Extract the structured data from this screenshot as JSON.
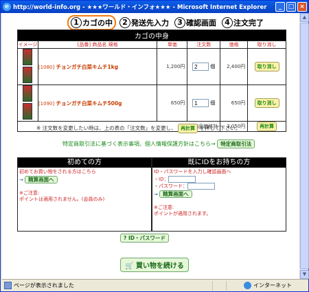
{
  "window": {
    "title": "http://world-info.org - ★★★ワールド・インフォ★★★ - Microsoft Internet Explorer"
  },
  "steps": [
    {
      "num": "1",
      "label": "カゴの中"
    },
    {
      "num": "2",
      "label": "発送先入力"
    },
    {
      "num": "3",
      "label": "確認画面"
    },
    {
      "num": "4",
      "label": "注文完了"
    }
  ],
  "cart": {
    "title": "カゴの中身",
    "headers": {
      "image": "イメージ",
      "name": "[品番] 商品名 規格",
      "price": "単価",
      "qty": "注文数",
      "subtotal": "価格",
      "cancel": "取り消し"
    },
    "items": [
      {
        "code": "[1080]",
        "name": "チョンガチ白菜キムチ1kg",
        "price": "1,200円",
        "qty": "2",
        "unit": "個",
        "subtotal": "2,400円",
        "cancel": "取り消し"
      },
      {
        "code": "[1090]",
        "name": "チョンガチ白菜キムチ500g",
        "price": "650円",
        "qty": "1",
        "unit": "個",
        "subtotal": "650円",
        "cancel": "取り消し"
      }
    ],
    "total_label": "商品価格計",
    "total": "3,050円",
    "recalc": "再計算"
  },
  "note": {
    "before": "※ 注文数を変更したい時は、上の表の「注文数」を変更し、",
    "button": "再計算",
    "after": "を押して下さい。"
  },
  "tokutei": {
    "text": "特定商取引法に基づく表示事項、個人情報保護方針はこちら→",
    "button": "特定商取引法"
  },
  "first_time": {
    "title": "初めての方",
    "line1": "初めてお買い物をされる方はこちら",
    "button": "精算画面へ",
    "caution": "※ご注意:",
    "caution_text": "ポイントは適用されません。(会員のみ)"
  },
  "member": {
    "title": "既にIDをお持ちの方",
    "line1": "ID・パスワードを入力し確認画面へ",
    "id_label": "・ID：",
    "pw_label": "・パスワード：",
    "button": "精算画面へ",
    "caution": "※ご注意:",
    "caution_text": "ポイントが適用されます。"
  },
  "idpw_button": "ID・パスワード",
  "continue_button": "買い物を続ける",
  "status": {
    "text": "ページが表示されました",
    "zone": "インターネット"
  }
}
